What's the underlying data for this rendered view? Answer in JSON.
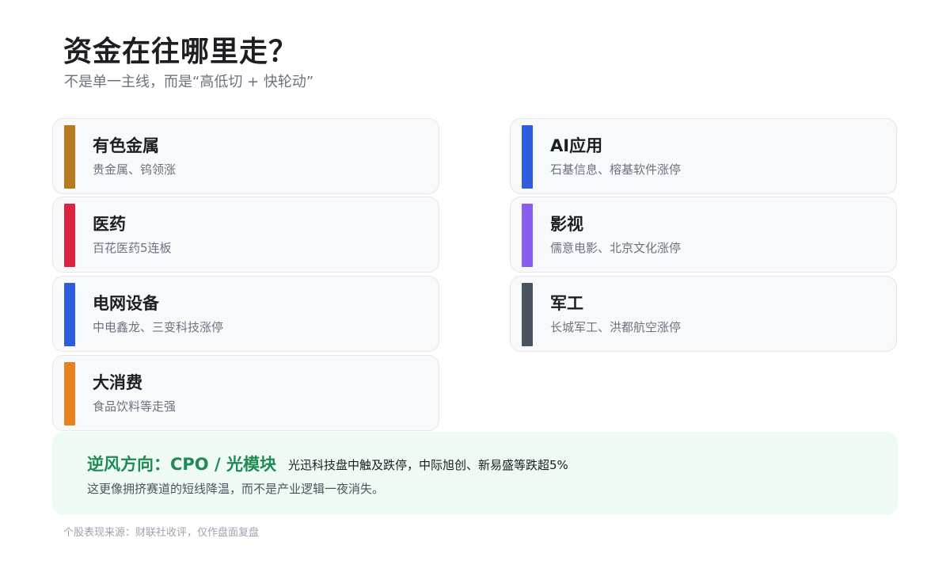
{
  "header": {
    "title": "资金在往哪里走？",
    "subtitle": "不是单一主线，而是“高低切 + 快轮动”"
  },
  "sectors": [
    {
      "name": "有色金属",
      "desc": "贵金属、钨领涨",
      "color": "#b87a22"
    },
    {
      "name": "AI应用",
      "desc": "石基信息、榕基软件涨停",
      "color": "#2f5be0"
    },
    {
      "name": "医药",
      "desc": "百花医药5连板",
      "color": "#dc2440"
    },
    {
      "name": "影视",
      "desc": "儒意电影、北京文化涨停",
      "color": "#8a5cf0"
    },
    {
      "name": "电网设备",
      "desc": "中电鑫龙、三变科技涨停",
      "color": "#2f5be0"
    },
    {
      "name": "军工",
      "desc": "长城军工、洪都航空涨停",
      "color": "#4a5260"
    },
    {
      "name": "大消费",
      "desc": "食品饮料等走强",
      "color": "#e8821e"
    }
  ],
  "against": {
    "lead": "逆风方向：CPO / 光模块",
    "detail": "光迅科技盘中触及跌停，中际旭创、新易盛等跌超5%",
    "note": "这更像拥挤赛道的短线降温，而不是产业逻辑一夜消失。"
  },
  "footer": {
    "source": "个股表现来源：财联社收评，仅作盘面复盘"
  }
}
